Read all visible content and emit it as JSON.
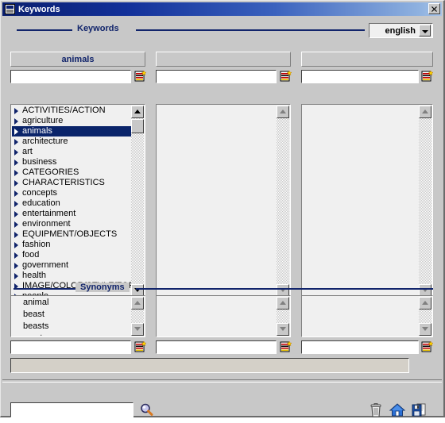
{
  "window": {
    "title": "Keywords",
    "title_icon": "window-app-icon",
    "close_label": "✕"
  },
  "keywords_group": {
    "label": "Keywords",
    "language_select": {
      "value": "english",
      "icon": "chevron-down-icon"
    }
  },
  "columns": [
    {
      "header": "animals",
      "input_value": "",
      "icon": "new-list-entry-icon",
      "scroll": "active"
    },
    {
      "header": "",
      "input_value": "",
      "icon": "new-list-entry-icon",
      "scroll": "disabled"
    },
    {
      "header": "",
      "input_value": "",
      "icon": "new-list-entry-icon",
      "scroll": "disabled"
    }
  ],
  "keyword_tree": {
    "selected": "animals",
    "items": [
      "ACTIVITIES/ACTION",
      "agriculture",
      "animals",
      "architecture",
      "art",
      "business",
      "CATEGORIES",
      "CHARACTERISTICS",
      "concepts",
      "education",
      "entertainment",
      "environment",
      "EQUIPMENT/OBJECTS",
      "fashion",
      "food",
      "government",
      "health",
      "IMAGE/COLOR/STYLE/FOR",
      "people"
    ]
  },
  "synonyms_group": {
    "label": "Synonyms",
    "columns": [
      {
        "items": [
          "animal",
          "beast",
          "beasts",
          "creature"
        ],
        "input_value": "",
        "icon": "new-list-entry-icon",
        "scroll": "disabled"
      },
      {
        "items": [],
        "input_value": "",
        "icon": "new-list-entry-icon",
        "scroll": "disabled"
      },
      {
        "items": [],
        "input_value": "",
        "icon": "new-list-entry-icon",
        "scroll": "disabled"
      }
    ]
  },
  "status_bar": {
    "text": ""
  },
  "bottom_bar": {
    "search_value": "",
    "search_icon": "magnifier-icon",
    "tools": [
      {
        "name": "delete-button",
        "icon": "trash-icon"
      },
      {
        "name": "home-button",
        "icon": "home-icon"
      },
      {
        "name": "save-button",
        "icon": "save-disk-icon"
      }
    ]
  },
  "colors": {
    "face": "#c8c8c8",
    "accent_navy": "#11246b",
    "selection": "#0a246a",
    "status_bar": "#d4d0c8",
    "title_start": "#0a1f6e",
    "title_end": "#a8c4e8"
  }
}
